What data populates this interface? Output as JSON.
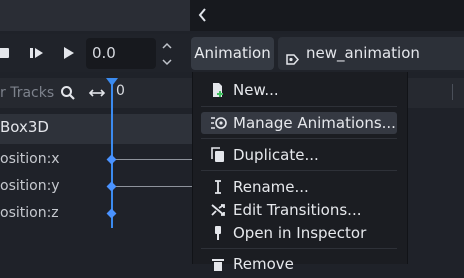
{
  "top": {
    "collapse_icon": "chevron-left-icon"
  },
  "transport": {
    "time_value": "0.0",
    "icons": [
      "stop-icon",
      "play-from-start-icon",
      "play-icon"
    ]
  },
  "animation_button": {
    "label": "Animation"
  },
  "animation_select": {
    "value": "new_animation",
    "icon": "animation-icon"
  },
  "tracks_header": {
    "filter_placeholder": "r Tracks",
    "timeline_start": "0"
  },
  "tracks": {
    "node": "Box3D",
    "items": [
      "osition:x",
      "osition:y",
      "osition:z"
    ]
  },
  "menu": {
    "items": [
      {
        "label": "New...",
        "icon": "new-file-icon"
      },
      {
        "label": "Manage Animations...",
        "icon": "animation-library-icon",
        "hovered": true
      },
      {
        "label": "Duplicate...",
        "icon": "duplicate-icon"
      },
      {
        "label": "Rename...",
        "icon": "rename-cursor-icon"
      },
      {
        "label": "Edit Transitions...",
        "icon": "transitions-icon"
      },
      {
        "label": "Open in Inspector",
        "icon": "inspector-icon"
      },
      {
        "label": "Remove",
        "icon": "trash-icon"
      }
    ]
  },
  "colors": {
    "accent": "#3b8bf0",
    "menu_bg": "#1b1d22",
    "hover_bg": "#353942"
  }
}
